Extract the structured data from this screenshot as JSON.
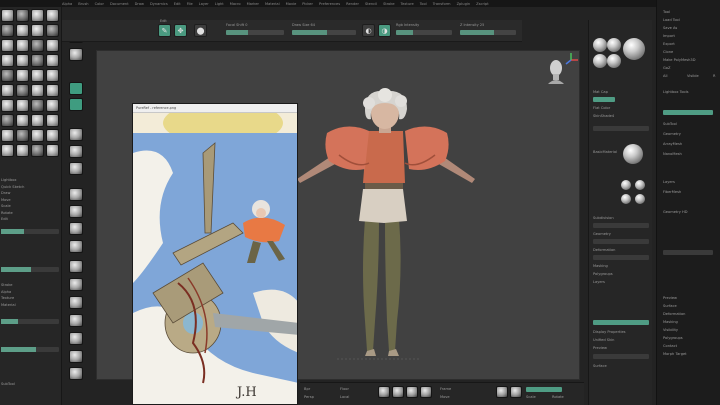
{
  "menubar": {
    "items": [
      "Alpha",
      "Brush",
      "Color",
      "Document",
      "Draw",
      "Dynamics",
      "Edit",
      "File",
      "Layer",
      "Light",
      "Macro",
      "Marker",
      "Material",
      "Movie",
      "Picker",
      "Preferences",
      "Render",
      "Stencil",
      "Stroke",
      "Texture",
      "Tool",
      "Transform",
      "Zplugin",
      "Zscript"
    ]
  },
  "toolbar": {
    "edit_label": "Edit",
    "draw_label": "Draw",
    "focal_label": "Focal Shift 0",
    "draw_size_label": "Draw Size 64",
    "rgb_label": "Rgb Intensity",
    "z_intensity_label": "Z Intensity 25"
  },
  "reference_window": {
    "title": "PureRef - reference.png",
    "signature": "J.H"
  },
  "left_panel": {
    "list_items": [
      "Lightbox",
      "Quick Sketch",
      "Draw",
      "Move",
      "Scale",
      "Rotate",
      "Edit"
    ],
    "lower_items": [
      "Stroke",
      "Alpha",
      "Texture",
      "Material"
    ],
    "bottom_label": "SubTool"
  },
  "right_panel": {
    "labels": [
      "Mat Cap",
      "Flat Color",
      "SkinShade4",
      "BasicMaterial",
      "Subdivision",
      "Geometry",
      "Deformation",
      "Masking",
      "Polygroups",
      "Layers",
      "Display Properties",
      "Unified Skin",
      "Preview",
      "Surface"
    ],
    "far_labels": [
      "Tool",
      "Load Tool",
      "Save As",
      "Import",
      "Export",
      "Clone",
      "Make PolyMesh3D",
      "GoZ",
      "All",
      "Visible",
      "R",
      "Lightbox Tools",
      "SubTool",
      "Geometry",
      "ArrayMesh",
      "NanoMesh",
      "Layers",
      "FiberMesh",
      "Geometry HD",
      "Preview",
      "Surface",
      "Deformation",
      "Masking",
      "Visibility",
      "Polygroups",
      "Contact",
      "Morph Target"
    ]
  },
  "bottombar": {
    "labels": [
      "Bpr",
      "Persp",
      "Floor",
      "Local",
      "Frame",
      "Move",
      "Scale",
      "Rotate"
    ]
  },
  "colors": {
    "accent": "#4f9c84",
    "canvas_bg": "#414141",
    "panel_bg": "#262626"
  }
}
